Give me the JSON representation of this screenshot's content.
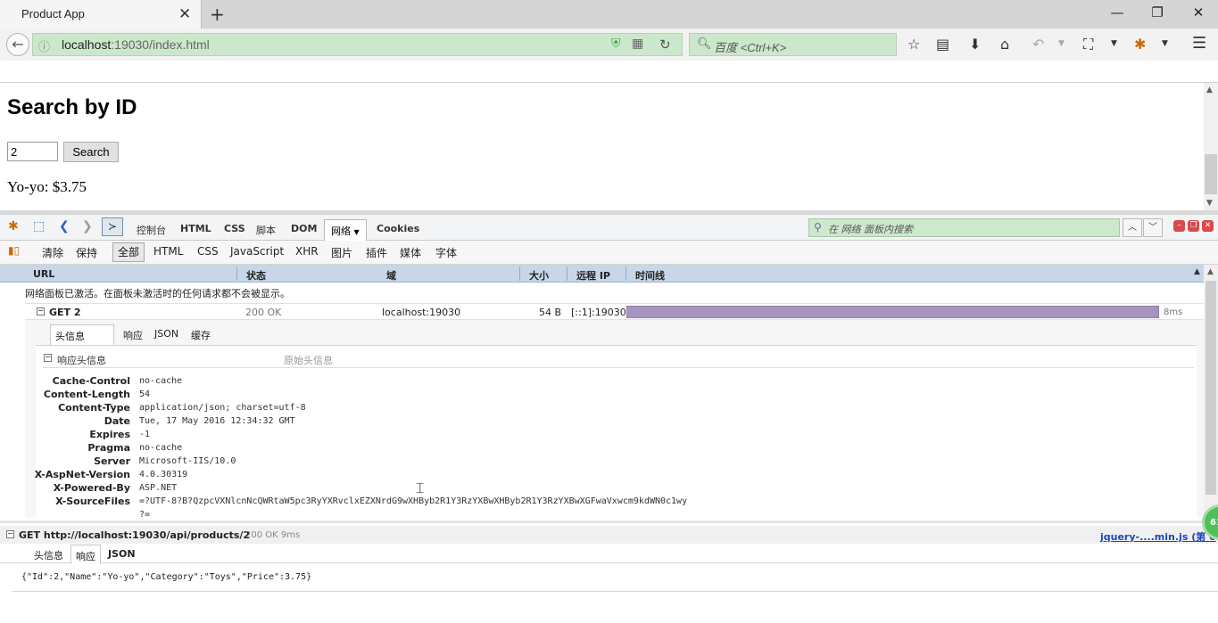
{
  "browser": {
    "tab_title": "Product App",
    "tab_close": "✕",
    "new_tab": "+",
    "window_controls": [
      "—",
      "❐",
      "✕"
    ],
    "url_host": "localhost",
    "url_rest": ":19030/index.html",
    "search_placeholder": "百度 <Ctrl+K>"
  },
  "page": {
    "title": "Search by ID",
    "id_input_value": "2",
    "search_button": "Search",
    "result": "Yo-yo: $3.75"
  },
  "firebug": {
    "tabs": [
      "控制台",
      "HTML",
      "CSS",
      "脚本",
      "DOM",
      "网络",
      "Cookies"
    ],
    "search_placeholder": "在 网络 面板内搜索",
    "net_toolbar": [
      "清除",
      "保持",
      "全部",
      "HTML",
      "CSS",
      "JavaScript",
      "XHR",
      "图片",
      "插件",
      "媒体",
      "字体"
    ],
    "columns": [
      "URL",
      "状态",
      "域",
      "大小",
      "远程 IP",
      "时间线"
    ],
    "notice": "网络面板已激活。在面板未激活时的任何请求都不会被显示。",
    "request": {
      "label": "GET 2",
      "status": "200 OK",
      "domain": "localhost:19030",
      "size": "54 B",
      "remote_ip": "[::1]:19030",
      "time": "8ms",
      "timeline_fraction": 0.93
    },
    "detail_tabs": [
      "头信息",
      "响应",
      "JSON",
      "缓存"
    ],
    "response_headers_title": "响应头信息",
    "raw_headers": "原始头信息",
    "headers": [
      {
        "k": "Cache-Control",
        "v": "no-cache"
      },
      {
        "k": "Content-Length",
        "v": "54"
      },
      {
        "k": "Content-Type",
        "v": "application/json; charset=utf-8"
      },
      {
        "k": "Date",
        "v": "Tue, 17 May 2016 12:34:32 GMT"
      },
      {
        "k": "Expires",
        "v": "-1"
      },
      {
        "k": "Pragma",
        "v": "no-cache"
      },
      {
        "k": "Server",
        "v": "Microsoft-IIS/10.0"
      },
      {
        "k": "X-AspNet-Version",
        "v": "4.0.30319"
      },
      {
        "k": "X-Powered-By",
        "v": "ASP.NET"
      },
      {
        "k": "X-SourceFiles",
        "v": "=?UTF-8?B?QzpcVXNlcnNcQWRtaW5pc3RyYXRvclxEZXNrdG9wXHByb2R1Y3RzYXBwXHByb2R1Y3RzYXBwXGFwaVxwcm9kdWN0c1wy"
      },
      {
        "k": "",
        "v": "?="
      }
    ]
  },
  "console": {
    "request": "GET http://localhost:19030/api/products/2",
    "status": "200 OK 9ms",
    "source": "jquery-....min.js (第 6",
    "tabs": [
      "头信息",
      "响应",
      "JSON"
    ],
    "body": "{\"Id\":2,\"Name\":\"Yo-yo\",\"Category\":\"Toys\",\"Price\":3.75}",
    "badge": "61"
  },
  "colors": {
    "urlbar_bg": "#cce8cc",
    "timeline_bar": "#a594c0",
    "column_header": "#c7d6e8",
    "source_link": "#1848c4"
  }
}
